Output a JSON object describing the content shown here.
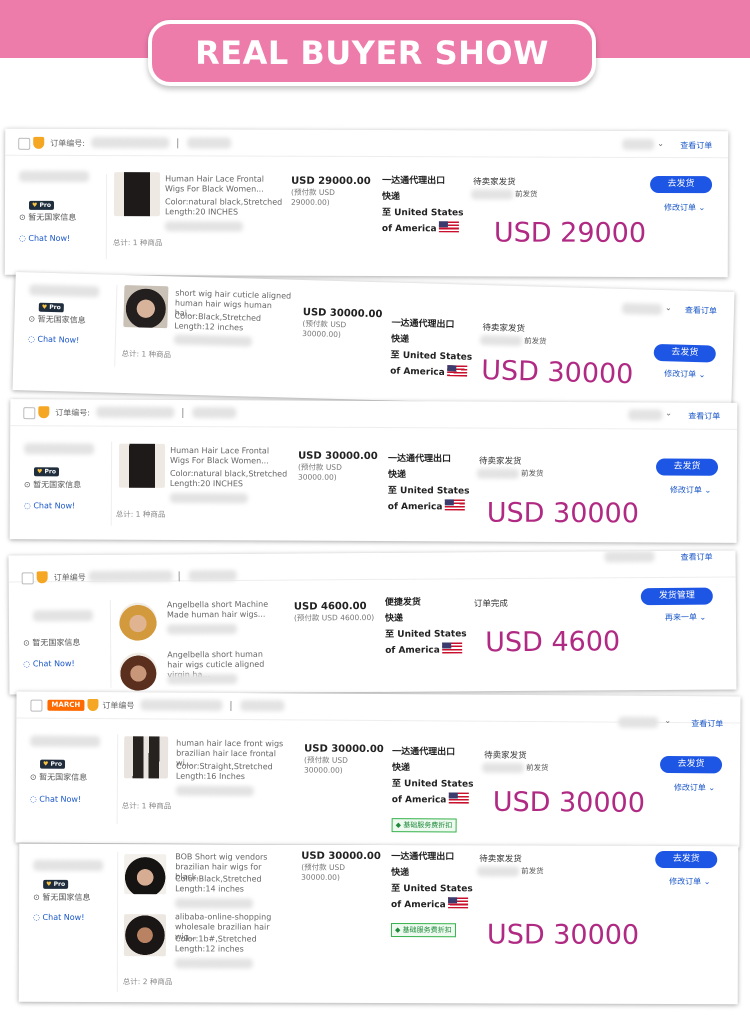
{
  "banner": {
    "title": "REAL BUYER SHOW"
  },
  "common": {
    "order_no_label": "订单编号:",
    "view_order": "查看订单",
    "pro_badge": "Pro",
    "no_country": "暂无国家信息",
    "chat_now": "Chat Now!",
    "modify_order": "修改订单",
    "express": "快递",
    "to_label": "至",
    "country": "United States of America",
    "march_badge": "MARCH"
  },
  "orders": [
    {
      "order_no_label": "订单编号:",
      "pro_badge": "Pro",
      "products": [
        {
          "title": "Human Hair Lace Frontal Wigs For Black Women...",
          "color": "Color:natural black,Stretched",
          "length": "Length:20 INCHES"
        }
      ],
      "price": "USD 29000.00",
      "prepay": "(预付款 USD 29000.00)",
      "logistics": "一达通代理出口",
      "status": "待卖家发货",
      "status_sub": "前发货",
      "button": "去发货",
      "total": "总计: 1 种商品",
      "amount": "USD 29000"
    },
    {
      "order_no_label": "",
      "pro_badge": "Pro",
      "products": [
        {
          "title": "short wig hair cuticle aligned human hair wigs human hai...",
          "color": "Color:Black,Stretched",
          "length": "Length:12 inches"
        }
      ],
      "price": "USD 30000.00",
      "prepay": "(预付款 USD 30000.00)",
      "logistics": "一达通代理出口",
      "status": "待卖家发货",
      "status_sub": "前发货",
      "button": "去发货",
      "total": "总计: 1 种商品",
      "amount": "USD 30000"
    },
    {
      "order_no_label": "订单编号:",
      "pro_badge": "Pro",
      "products": [
        {
          "title": "Human Hair Lace Frontal Wigs For Black Women...",
          "color": "Color:natural black,Stretched",
          "length": "Length:20 INCHES"
        }
      ],
      "price": "USD 30000.00",
      "prepay": "(预付款 USD 30000.00)",
      "logistics": "一达通代理出口",
      "status": "待卖家发货",
      "status_sub": "前发货",
      "button": "去发货",
      "total": "总计: 1 种商品",
      "amount": "USD 30000"
    },
    {
      "order_no_label": "订单编号",
      "products": [
        {
          "title": "Angelbella short Machine Made human hair wigs...",
          "color": "",
          "length": ""
        },
        {
          "title": "Angelbella short human hair wigs cuticle aligned virgin ha...",
          "color": "",
          "length": ""
        }
      ],
      "price": "USD 4600.00",
      "prepay": "(预付款 USD 4600.00)",
      "logistics": "便捷发货",
      "status": "订单完成",
      "button": "发货管理",
      "again": "再来一单",
      "amount": "USD 4600"
    },
    {
      "order_no_label": "订单编号",
      "pro_badge": "Pro",
      "products": [
        {
          "title": "human hair lace front wigs brazilian hair lace frontal wi...",
          "color": "Color:Straight,Stretched",
          "length": "Length:16 Inches"
        }
      ],
      "price": "USD 30000.00",
      "prepay": "(预付款 USD 30000.00)",
      "logistics": "一达通代理出口",
      "status": "待卖家发货",
      "status_sub": "前发货",
      "service_tag": "基础服务费折扣",
      "button": "去发货",
      "total": "总计: 1 种商品",
      "amount": "USD 30000"
    },
    {
      "pro_badge": "Pro",
      "products": [
        {
          "title": "BOB Short wig vendors brazilian hair wigs for black...",
          "color": "Color:Black,Stretched",
          "length": "Length:14 inches"
        },
        {
          "title": "alibaba-online-shopping wholesale brazilian hair wig...",
          "color": "Color:1b#,Stretched",
          "length": "Length:12 inches"
        }
      ],
      "price": "USD 30000.00",
      "prepay": "(预付款 USD 30000.00)",
      "logistics": "一达通代理出口",
      "status": "待卖家发货",
      "status_sub": "前发货",
      "service_tag": "基础服务费折扣",
      "button": "去发货",
      "total": "总计: 2 种商品",
      "amount": "USD 30000"
    }
  ]
}
